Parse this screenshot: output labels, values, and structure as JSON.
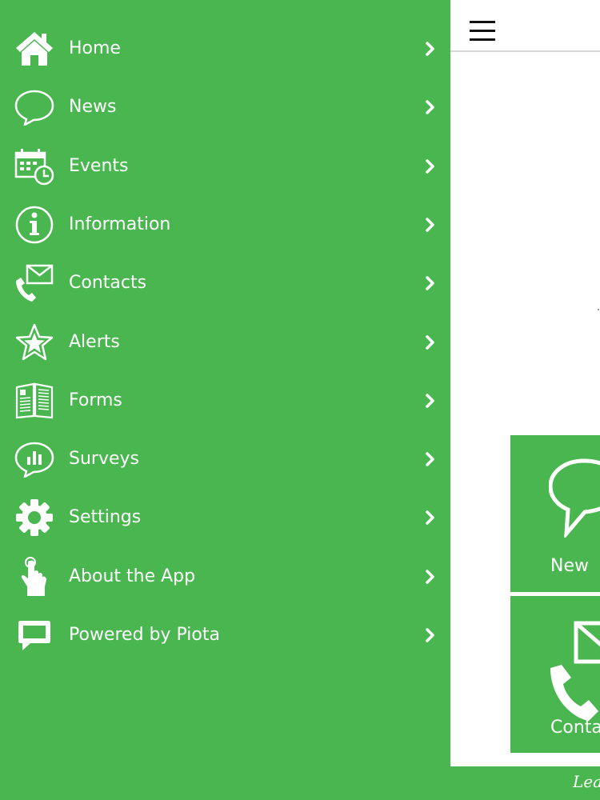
{
  "colors": {
    "brand_green": "#4ab650",
    "text": "#ffffff",
    "panel": "#ffffff"
  },
  "menu": {
    "items": [
      {
        "label": "Home",
        "icon": "home-icon"
      },
      {
        "label": "News",
        "icon": "speech-bubble-icon"
      },
      {
        "label": "Events",
        "icon": "calendar-clock-icon"
      },
      {
        "label": "Information",
        "icon": "info-icon"
      },
      {
        "label": "Contacts",
        "icon": "phone-mail-icon"
      },
      {
        "label": "Alerts",
        "icon": "star-icon"
      },
      {
        "label": "Forms",
        "icon": "forms-icon"
      },
      {
        "label": "Surveys",
        "icon": "survey-chart-bubble-icon"
      },
      {
        "label": "Settings",
        "icon": "gear-icon"
      },
      {
        "label": "About the App",
        "icon": "touch-hand-icon"
      },
      {
        "label": "Powered by Piota",
        "icon": "piota-bubble-icon"
      }
    ]
  },
  "background": {
    "tiles": [
      {
        "label": "New",
        "icon": "speech-bubble-icon"
      },
      {
        "label": "Conta",
        "icon": "phone-mail-icon"
      }
    ],
    "bottom_text": "Lea"
  }
}
